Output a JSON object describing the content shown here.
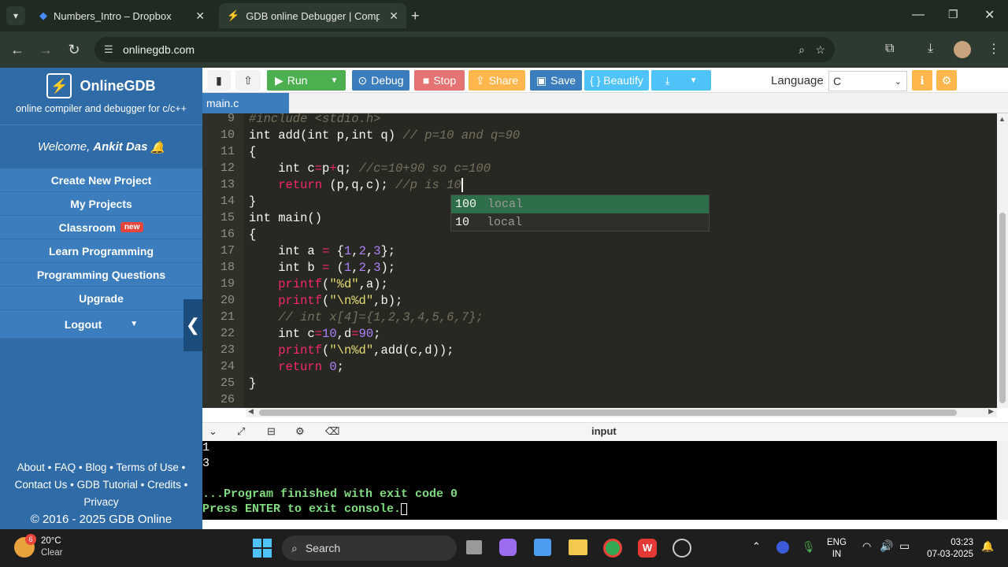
{
  "browser": {
    "tabs": [
      {
        "title": "Numbers_Intro – Dropbox"
      },
      {
        "title": "GDB online Debugger | Compil"
      }
    ],
    "url": "onlinegdb.com"
  },
  "sidebar": {
    "brand": "OnlineGDB",
    "tagline": "online compiler and debugger for c/c++",
    "welcome_prefix": "Welcome, ",
    "user": "Ankit Das",
    "menu": [
      "Create New Project",
      "My Projects",
      "Classroom",
      "Learn Programming",
      "Programming Questions",
      "Upgrade",
      "Logout"
    ],
    "classroom_badge": "new",
    "footer_line1": "About • FAQ • Blog • Terms of Use •",
    "footer_line2": "Contact Us • GDB Tutorial • Credits •",
    "footer_line3": "Privacy",
    "footer_line4": "© 2016 - 2025 GDB Online"
  },
  "toolbar": {
    "run": "Run",
    "debug": "Debug",
    "stop": "Stop",
    "share": "Share",
    "save": "Save",
    "beautify": "{ } Beautify",
    "language_label": "Language",
    "language_value": "C"
  },
  "editor": {
    "filename": "main.c",
    "line_numbers": [
      "9",
      "10",
      "11",
      "12",
      "13",
      "14",
      "15",
      "16",
      "17",
      "18",
      "19",
      "20",
      "21",
      "22",
      "23",
      "24",
      "25",
      "26"
    ],
    "autocomplete": [
      {
        "value": "100",
        "kind": "local"
      },
      {
        "value": "10",
        "kind": "local"
      }
    ]
  },
  "console": {
    "label": "input",
    "lines": [
      "1",
      "3",
      "",
      "...Program finished with exit code 0",
      "Press ENTER to exit console."
    ]
  },
  "taskbar": {
    "weather_badge": "6",
    "temp": "20°C",
    "condition": "Clear",
    "search": "Search",
    "lang1": "ENG",
    "lang2": "IN",
    "time": "03:23",
    "date": "07-03-2025"
  }
}
